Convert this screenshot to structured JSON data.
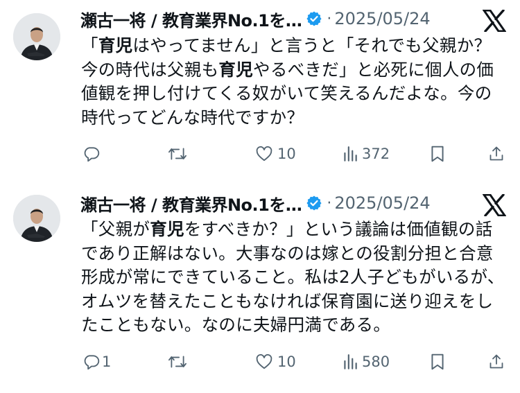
{
  "posts": [
    {
      "author_name": "瀬古一将 / 教育業界No.1を…",
      "separator": "·",
      "date": "2025/05/24",
      "text_segments": [
        {
          "text": "「",
          "bold": false
        },
        {
          "text": "育児",
          "bold": true
        },
        {
          "text": "はやってません」と言うと「それでも父親か？今の時代は父親も",
          "bold": false
        },
        {
          "text": "育児",
          "bold": true
        },
        {
          "text": "やるべきだ」と必死に個人の価値観を押し付けてくる奴がいて笑えるんだよな。今の時代ってどんな時代ですか？",
          "bold": false
        }
      ],
      "reply_count": "",
      "repost_count": "",
      "like_count": "10",
      "view_count": "372"
    },
    {
      "author_name": "瀬古一将 / 教育業界No.1を…",
      "separator": "·",
      "date": "2025/05/24",
      "text_segments": [
        {
          "text": "「父親が",
          "bold": false
        },
        {
          "text": "育児",
          "bold": true
        },
        {
          "text": "をすべきか？」という議論は価値観の話であり正解はない。大事なのは嫁との役割分担と合意形成が常にできていること。私は2人子どもがいるが、オムツを替えたこともなければ保育園に送り迎えをしたこともない。なのに夫婦円満である。",
          "bold": false
        }
      ],
      "reply_count": "1",
      "repost_count": "",
      "like_count": "10",
      "view_count": "580"
    }
  ],
  "icons": {
    "verified": "verified-badge-icon",
    "platform": "x-logo-icon",
    "reply": "reply-icon",
    "repost": "repost-icon",
    "like": "heart-icon",
    "views": "views-chart-icon",
    "bookmark": "bookmark-icon",
    "share": "share-icon"
  },
  "colors": {
    "verified_blue": "#1d9bf0",
    "text_primary": "#0f1419",
    "text_secondary": "#536471",
    "divider": "#e3e6e8"
  }
}
